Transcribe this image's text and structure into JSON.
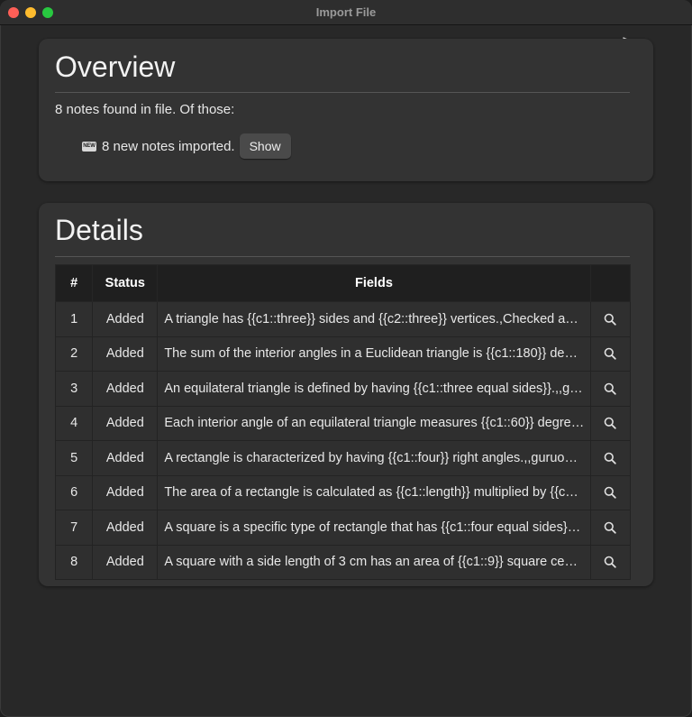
{
  "window": {
    "title": "Import File"
  },
  "overview": {
    "heading": "Overview",
    "summary": "8 notes found in file. Of those:",
    "new_badge": "NEW",
    "imported_text": "8 new notes imported.",
    "show_label": "Show"
  },
  "details": {
    "heading": "Details",
    "columns": [
      "#",
      "Status",
      "Fields",
      ""
    ],
    "rows": [
      {
        "num": "1",
        "status": "Added",
        "fields": "A triangle has {{c1::three}} sides and {{c2::three}} vertices.,Checked a…"
      },
      {
        "num": "2",
        "status": "Added",
        "fields": "The sum of the interior angles in a Euclidean triangle is {{c1::180}} deg…"
      },
      {
        "num": "3",
        "status": "Added",
        "fields": "An equilateral triangle is defined by having {{c1::three equal sides}}.,,g…"
      },
      {
        "num": "4",
        "status": "Added",
        "fields": "Each interior angle of an equilateral triangle measures {{c1::60}} degre…"
      },
      {
        "num": "5",
        "status": "Added",
        "fields": "A rectangle is characterized by having {{c1::four}} right angles.,,guruo…"
      },
      {
        "num": "6",
        "status": "Added",
        "fields": "The area of a rectangle is calculated as {{c1::length}} multiplied by {{c…"
      },
      {
        "num": "7",
        "status": "Added",
        "fields": "A square is a specific type of rectangle that has {{c1::four equal sides}}…"
      },
      {
        "num": "8",
        "status": "Added",
        "fields": "A square with a side length of 3 cm has an area of {{c1::9}} square cen…"
      }
    ],
    "row_action_icon": "magnifier-icon"
  },
  "colors": {
    "window_bg": "#282828",
    "card_bg": "#333333",
    "header_bg": "#1f1f1f",
    "close": "#fe5f57",
    "minimize": "#febc2e",
    "maximize": "#28c840"
  }
}
